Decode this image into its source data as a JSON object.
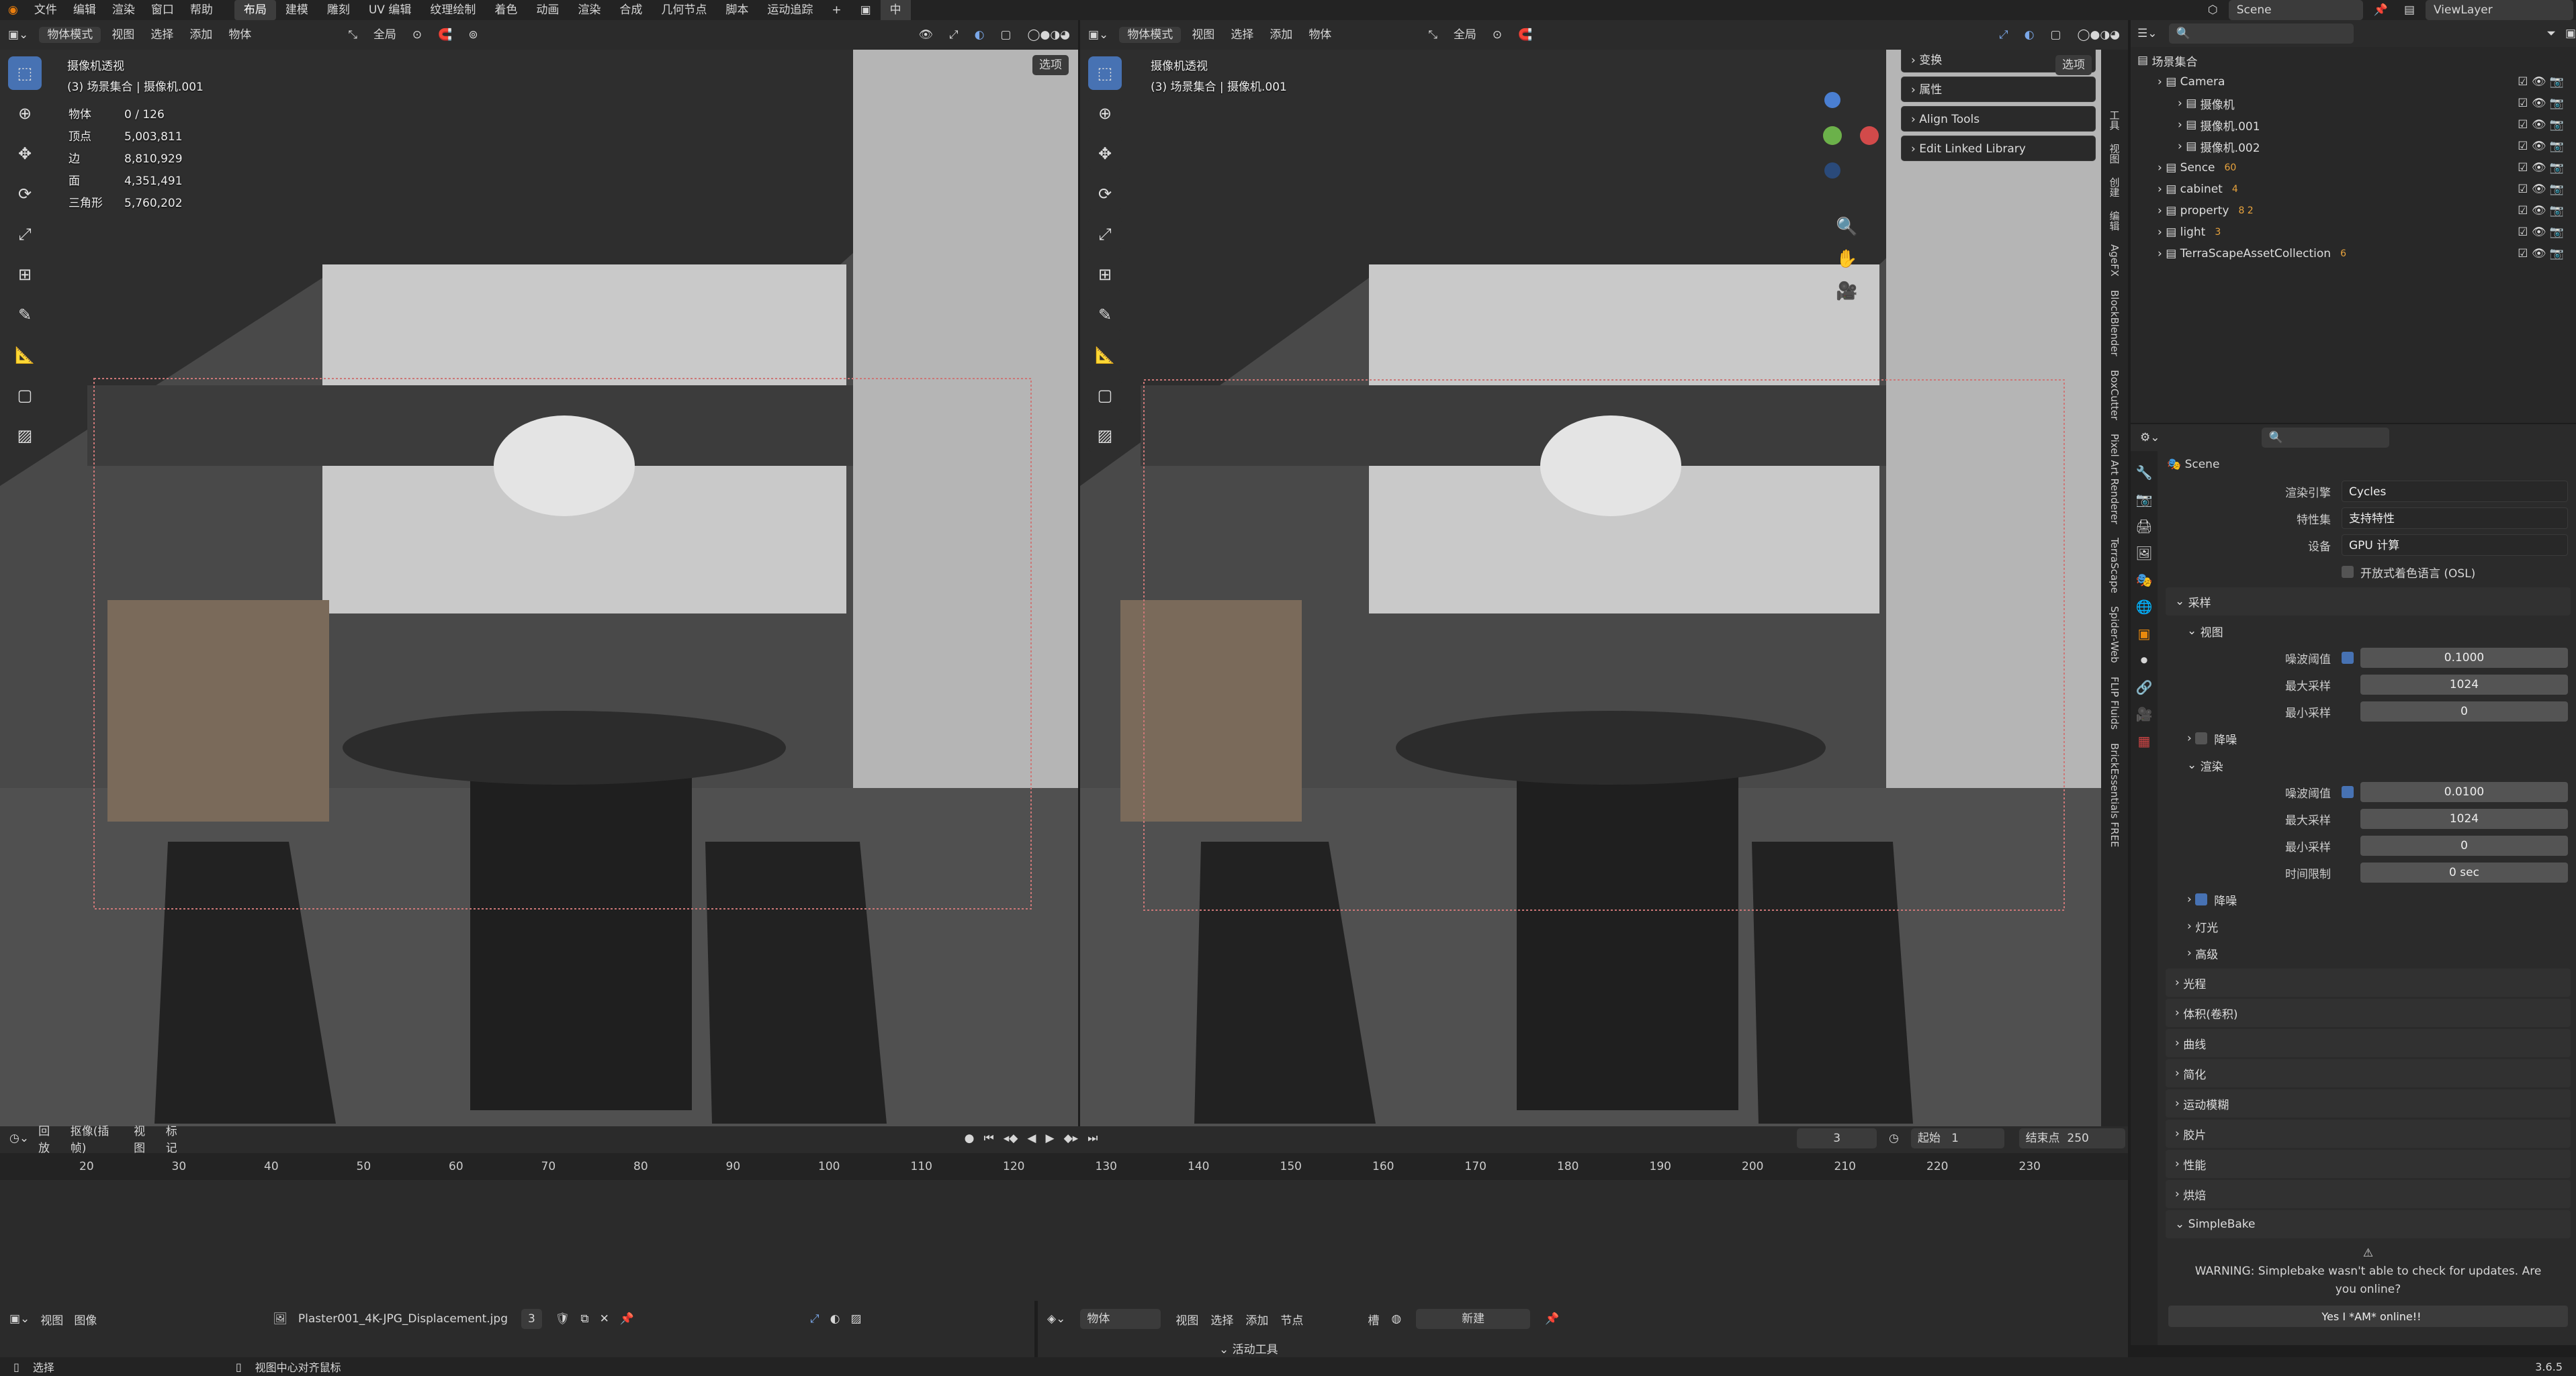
{
  "topmenu": {
    "items": [
      "文件",
      "编辑",
      "渲染",
      "窗口",
      "帮助"
    ],
    "workspaces": [
      "布局",
      "建模",
      "雕刻",
      "UV 编辑",
      "纹理绘制",
      "着色",
      "动画",
      "渲染",
      "合成",
      "几何节点",
      "脚本",
      "运动追踪"
    ],
    "ime": "中",
    "scene": "Scene",
    "viewlayer": "ViewLayer"
  },
  "vp_left": {
    "mode": "物体模式",
    "menus": [
      "视图",
      "选择",
      "添加",
      "物体"
    ],
    "orientation": "全局",
    "options": "选项",
    "cam_title": "摄像机透视",
    "cam_sub": "(3) 场景集合 | 摄像机.001",
    "stats": [
      [
        "物体",
        "0 / 126"
      ],
      [
        "顶点",
        "5,003,811"
      ],
      [
        "边",
        "8,810,929"
      ],
      [
        "面",
        "4,351,491"
      ],
      [
        "三角形",
        "5,760,202"
      ]
    ]
  },
  "vp_right": {
    "mode": "物体模式",
    "menus": [
      "视图",
      "选择",
      "添加",
      "物体"
    ],
    "orientation": "全局",
    "options": "选项",
    "cam_title": "摄像机透视",
    "cam_sub": "(3) 场景集合 | 摄像机.001",
    "npanels": [
      "变换",
      "属性",
      "Align Tools",
      "Edit Linked Library"
    ],
    "vtabs": [
      "工具",
      "视图",
      "创建",
      "编辑",
      "AgeFX",
      "BlockBlender",
      "BoxCutter",
      "Pixel Art Renderer",
      "TerraScape",
      "Spider-Web",
      "FLIP Fluids",
      "BrickEssentials FREE"
    ]
  },
  "outliner": {
    "root": "场景集合",
    "rows": [
      {
        "name": "Camera",
        "indent": 1,
        "badge": ""
      },
      {
        "name": "摄像机",
        "indent": 2,
        "badge": ""
      },
      {
        "name": "摄像机.001",
        "indent": 2,
        "badge": ""
      },
      {
        "name": "摄像机.002",
        "indent": 2,
        "badge": ""
      },
      {
        "name": "Sence",
        "indent": 1,
        "badge": "60"
      },
      {
        "name": "cabinet",
        "indent": 1,
        "badge": "4"
      },
      {
        "name": "property",
        "indent": 1,
        "badge": "8 2"
      },
      {
        "name": "light",
        "indent": 1,
        "badge": "3"
      },
      {
        "name": "TerraScapeAssetCollection",
        "indent": 1,
        "badge": "6"
      }
    ]
  },
  "props": {
    "scene": "Scene",
    "engine_label": "渲染引擎",
    "engine": "Cycles",
    "feature_label": "特性集",
    "feature": "支持特性",
    "device_label": "设备",
    "device": "GPU 计算",
    "osl": "开放式着色语言 (OSL)",
    "sampling": "采样",
    "viewport": "视图",
    "noise_label": "噪波阈值",
    "vp_noise": "0.1000",
    "max_label": "最大采样",
    "vp_max": "1024",
    "min_label": "最小采样",
    "vp_min": "0",
    "denoise": "降噪",
    "render": "渲染",
    "r_noise": "0.0100",
    "r_max": "1024",
    "r_min": "0",
    "time_label": "时间限制",
    "r_time": "0 sec",
    "lights": "灯光",
    "advanced": "高级",
    "sections": [
      "光程",
      "体积(卷积)",
      "曲线",
      "简化",
      "运动模糊",
      "胶片",
      "性能",
      "烘焙"
    ],
    "simplebake": "SimpleBake",
    "warning": "WARNING: Simplebake wasn't able to check for updates. Are you online?",
    "online_btn": "Yes I *AM* online!!"
  },
  "timeline": {
    "menus": [
      "回放",
      "抠像(插帧)",
      "视图",
      "标记"
    ],
    "frame": "3",
    "start_label": "起始",
    "start": "1",
    "end_label": "结束点",
    "end": "250",
    "ticks": [
      "20",
      "30",
      "40",
      "50",
      "60",
      "70",
      "80",
      "90",
      "100",
      "110",
      "120",
      "130",
      "140",
      "150",
      "160",
      "170",
      "180",
      "190",
      "200",
      "210",
      "220",
      "230"
    ]
  },
  "imgeditor": {
    "menus": [
      "视图",
      "图像"
    ],
    "image": "Plaster001_4K-JPG_Displacement.jpg",
    "users": "3"
  },
  "nodeeditor": {
    "type": "物体",
    "menus": [
      "视图",
      "选择",
      "添加",
      "节点"
    ],
    "slot": "槽",
    "new_btn": "新建",
    "active_tool": "活动工具"
  },
  "status": {
    "left": "选择",
    "center": "视图中心对齐鼠标",
    "version": "3.6.5"
  }
}
